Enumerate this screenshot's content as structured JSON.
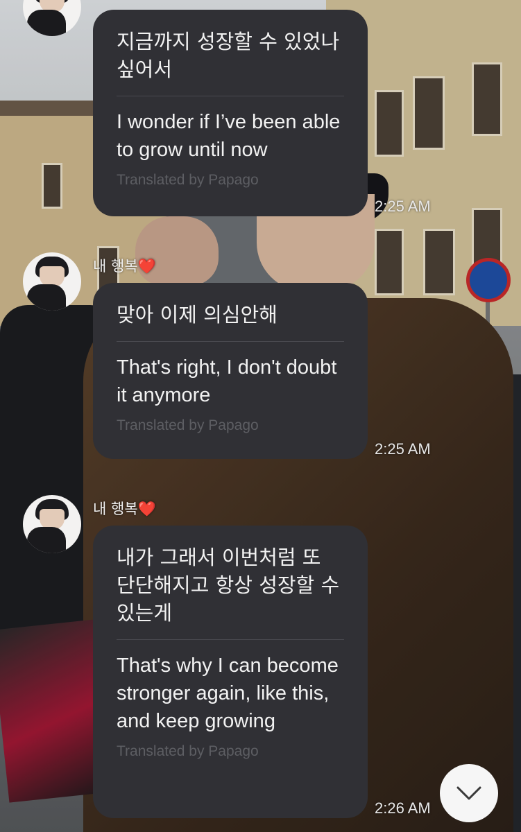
{
  "chat": {
    "sender_name": "내 행복",
    "sender_heart": "❤️",
    "translated_by": "Translated by Papago",
    "messages": [
      {
        "korean": "지금까지 성장할 수 있었나 싶어서",
        "english": "I wonder if I’ve been able to grow until now",
        "time": "2:25 AM"
      },
      {
        "korean": "맞아 이제 의심안해",
        "english": "That's right, I don't doubt it anymore",
        "time": "2:25 AM"
      },
      {
        "korean": "내가 그래서 이번처럼 또 단단해지고 항상 성장할 수 있는게",
        "english": "That's why I can become stronger again, like this, and keep growing",
        "time": "2:26 AM"
      }
    ]
  },
  "controls": {
    "scroll_down_icon": "chevron-down-icon"
  }
}
